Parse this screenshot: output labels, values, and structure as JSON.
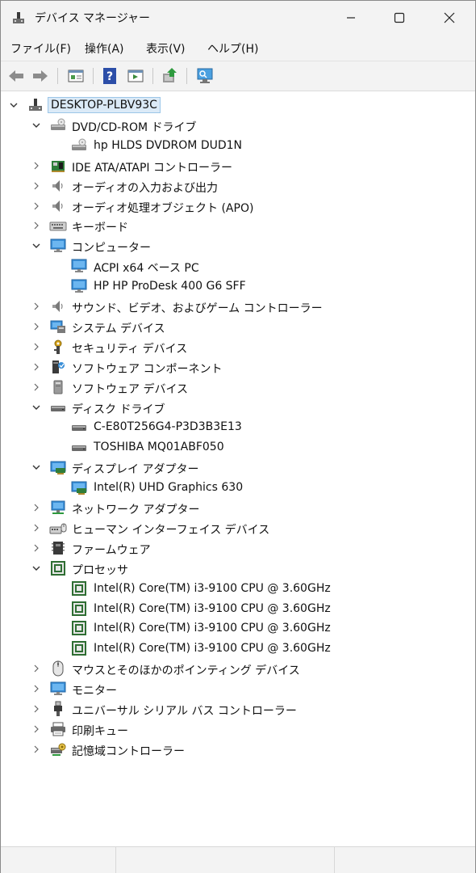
{
  "window": {
    "title": "デバイス マネージャー"
  },
  "menu": [
    "ファイル(F)",
    "操作(A)",
    "表示(V)",
    "ヘルプ(H)"
  ],
  "toolbar": [
    "back-icon",
    "forward-icon",
    "properties-icon",
    "help-icon",
    "run-icon",
    "update-driver-icon",
    "scan-hardware-icon"
  ],
  "tree": {
    "root": "DESKTOP-PLBV93C",
    "items": [
      {
        "label": "DVD/CD-ROM ドライブ",
        "icon": "dvd-drive-icon",
        "expanded": true,
        "children": [
          {
            "label": "hp HLDS DVDROM DUD1N",
            "icon": "dvd-drive-icon"
          }
        ]
      },
      {
        "label": "IDE ATA/ATAPI コントローラー",
        "icon": "ide-controller-icon",
        "expanded": false
      },
      {
        "label": "オーディオの入力および出力",
        "icon": "speaker-icon",
        "expanded": false
      },
      {
        "label": "オーディオ処理オブジェクト (APO)",
        "icon": "speaker-icon",
        "expanded": false
      },
      {
        "label": "キーボード",
        "icon": "keyboard-icon",
        "expanded": false
      },
      {
        "label": "コンピューター",
        "icon": "monitor-icon",
        "expanded": true,
        "children": [
          {
            "label": "ACPI x64 ベース PC",
            "icon": "monitor-icon"
          },
          {
            "label": "HP HP ProDesk 400 G6 SFF",
            "icon": "monitor-icon"
          }
        ]
      },
      {
        "label": "サウンド、ビデオ、およびゲーム コントローラー",
        "icon": "speaker-icon",
        "expanded": false
      },
      {
        "label": "システム デバイス",
        "icon": "system-devices-icon",
        "expanded": false
      },
      {
        "label": "セキュリティ デバイス",
        "icon": "security-key-icon",
        "expanded": false
      },
      {
        "label": "ソフトウェア コンポーネント",
        "icon": "software-component-icon",
        "expanded": false
      },
      {
        "label": "ソフトウェア デバイス",
        "icon": "software-device-icon",
        "expanded": false
      },
      {
        "label": "ディスク ドライブ",
        "icon": "disk-drive-icon",
        "expanded": true,
        "children": [
          {
            "label": "C-E80T256G4-P3D3B3E13",
            "icon": "disk-drive-icon"
          },
          {
            "label": "TOSHIBA MQ01ABF050",
            "icon": "disk-drive-icon"
          }
        ]
      },
      {
        "label": "ディスプレイ アダプター",
        "icon": "display-adapter-icon",
        "expanded": true,
        "children": [
          {
            "label": "Intel(R) UHD Graphics 630",
            "icon": "display-adapter-icon"
          }
        ]
      },
      {
        "label": "ネットワーク アダプター",
        "icon": "network-adapter-icon",
        "expanded": false
      },
      {
        "label": "ヒューマン インターフェイス デバイス",
        "icon": "hid-icon",
        "expanded": false
      },
      {
        "label": "ファームウェア",
        "icon": "firmware-icon",
        "expanded": false
      },
      {
        "label": "プロセッサ",
        "icon": "processor-icon",
        "expanded": true,
        "children": [
          {
            "label": "Intel(R) Core(TM) i3-9100 CPU @ 3.60GHz",
            "icon": "processor-icon"
          },
          {
            "label": "Intel(R) Core(TM) i3-9100 CPU @ 3.60GHz",
            "icon": "processor-icon"
          },
          {
            "label": "Intel(R) Core(TM) i3-9100 CPU @ 3.60GHz",
            "icon": "processor-icon"
          },
          {
            "label": "Intel(R) Core(TM) i3-9100 CPU @ 3.60GHz",
            "icon": "processor-icon"
          }
        ]
      },
      {
        "label": "マウスとそのほかのポインティング デバイス",
        "icon": "mouse-icon",
        "expanded": false
      },
      {
        "label": "モニター",
        "icon": "monitor-icon",
        "expanded": false
      },
      {
        "label": "ユニバーサル シリアル バス コントローラー",
        "icon": "usb-icon",
        "expanded": false
      },
      {
        "label": "印刷キュー",
        "icon": "printer-icon",
        "expanded": false
      },
      {
        "label": "記憶域コントローラー",
        "icon": "storage-controller-icon",
        "expanded": false
      }
    ]
  },
  "colors": {
    "window_bg": "#ffffff",
    "chrome_bg": "#f3f3f3",
    "root_highlight": "#dbeaf7",
    "root_border": "#9cc6e8"
  }
}
